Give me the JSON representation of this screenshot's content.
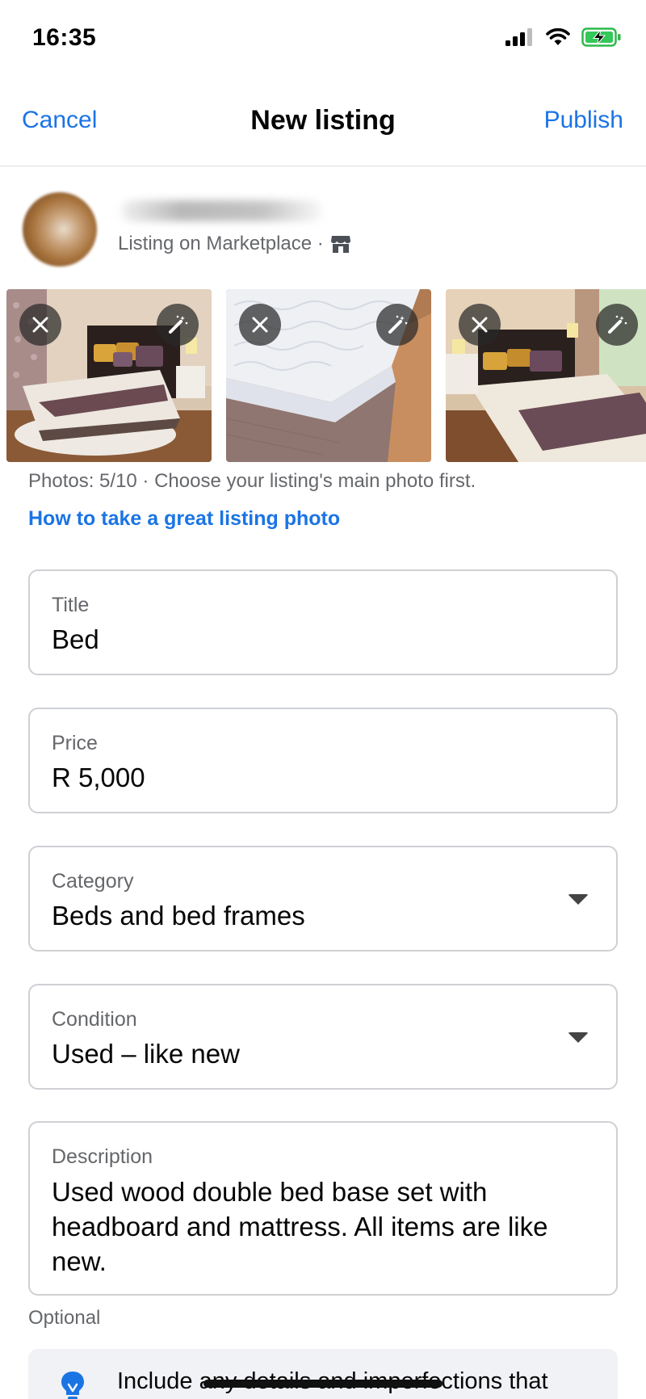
{
  "status_bar": {
    "time": "16:35"
  },
  "nav": {
    "cancel_label": "Cancel",
    "title": "New listing",
    "publish_label": "Publish"
  },
  "profile": {
    "listing_on": "Listing on Marketplace ·",
    "store_icon": "marketplace-store-icon"
  },
  "photos": {
    "items": [
      {
        "subject": "bedroom-with-bed",
        "remove_icon": "close-icon",
        "edit_icon": "magic-wand-icon"
      },
      {
        "subject": "mattress-closeup",
        "remove_icon": "close-icon",
        "edit_icon": "magic-wand-icon"
      },
      {
        "subject": "bedroom-with-bed-alt",
        "remove_icon": "close-icon",
        "edit_icon": "magic-wand-icon"
      }
    ],
    "hint": "Photos: 5/10 · Choose your listing's main photo first.",
    "tip_link": "How to take a great listing photo"
  },
  "form": {
    "title": {
      "label": "Title",
      "value": "Bed"
    },
    "price": {
      "label": "Price",
      "value": "R 5,000"
    },
    "category": {
      "label": "Category",
      "value": "Beds and bed frames"
    },
    "condition": {
      "label": "Condition",
      "value": "Used – like new"
    },
    "description": {
      "label": "Description",
      "value": "Used wood double bed base set with headboard and mattress. All items are like new."
    },
    "optional_label": "Optional"
  },
  "tip": {
    "icon": "lightbulb-icon",
    "text": "Include any details and imperfections that"
  },
  "colors": {
    "accent": "#1b74e4",
    "secondary_text": "#65676b",
    "border": "#ced0d4",
    "tip_bg": "#f0f2f5"
  }
}
